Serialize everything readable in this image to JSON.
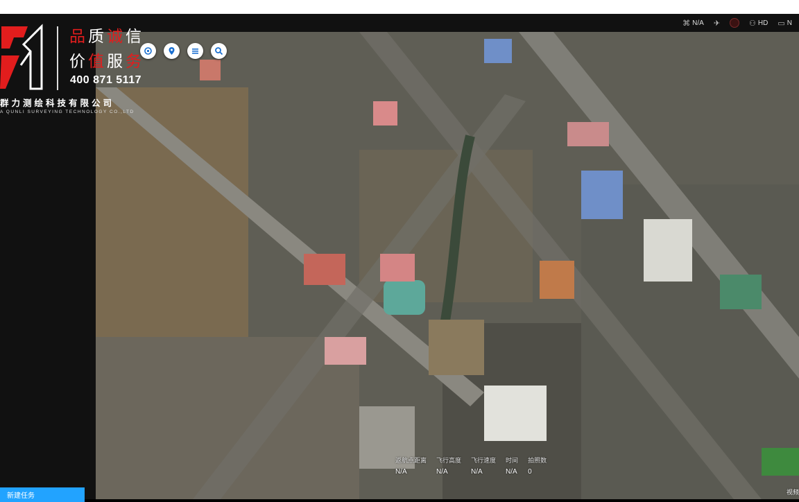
{
  "brand": {
    "slogan_line1": [
      {
        "text": "品",
        "red": true
      },
      {
        "text": "质",
        "red": false
      },
      {
        "text": "诚",
        "red": true
      },
      {
        "text": "信",
        "red": false
      }
    ],
    "slogan_line2": [
      {
        "text": "价",
        "red": false
      },
      {
        "text": "值",
        "red": true
      },
      {
        "text": "服",
        "red": false
      },
      {
        "text": "务",
        "red": true
      }
    ],
    "phone": "400 871 5117",
    "company_cn": "群力测绘科技有限公司",
    "company_en": "A QUNLI SURVEYING TECHNOLOGY CO.,LTD"
  },
  "status_bar": {
    "signal_value": "N/A",
    "hd_label": "HD",
    "last_label": "N"
  },
  "map_tools": [
    {
      "name": "target-tool",
      "icon": "target-icon"
    },
    {
      "name": "location-tool",
      "icon": "location-pin-icon"
    },
    {
      "name": "list-tool",
      "icon": "list-icon"
    },
    {
      "name": "search-tool",
      "icon": "search-icon"
    }
  ],
  "telemetry": {
    "home_distance": {
      "label": "返航点距离",
      "value": "N/A"
    },
    "altitude": {
      "label": "飞行高度",
      "value": "N/A"
    },
    "speed": {
      "label": "飞行速度",
      "value": "N/A"
    },
    "time": {
      "label": "时间",
      "value": "N/A"
    },
    "photos": {
      "label": "拍照数",
      "value": "0"
    }
  },
  "sidebar": {
    "new_task_label": "新建任务"
  },
  "corner_text": "视频"
}
